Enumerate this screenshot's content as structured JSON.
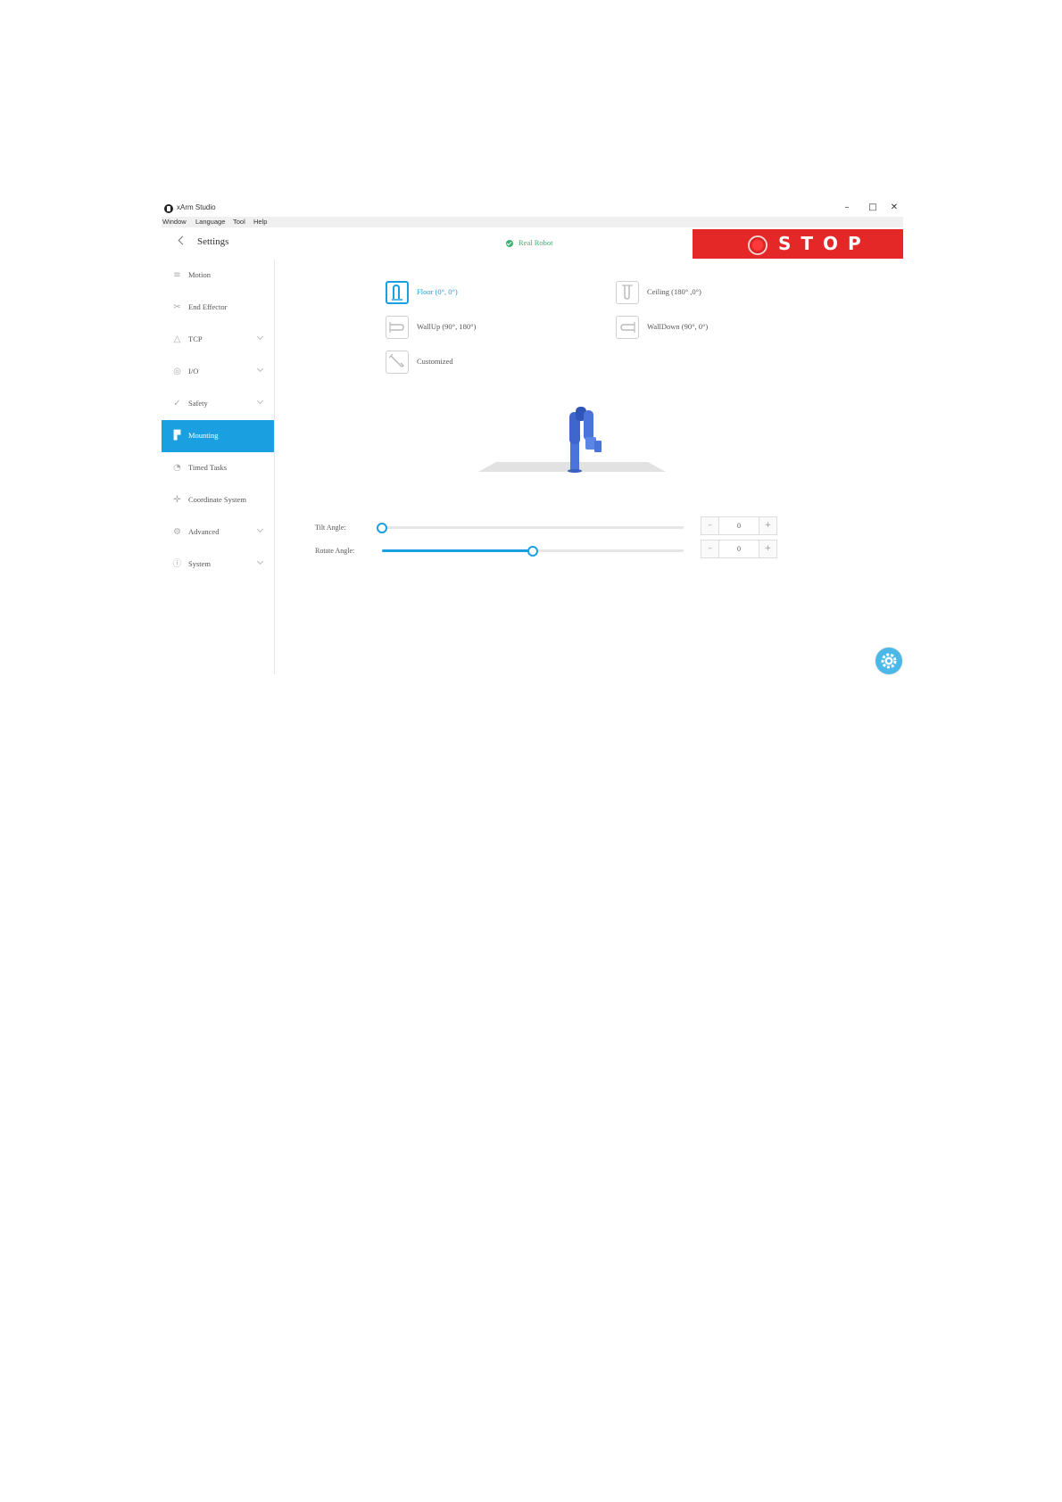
{
  "window": {
    "title": "xArm Studio",
    "controls": {
      "minimize": "–",
      "maximize": "□",
      "close": "✕"
    }
  },
  "menu": [
    "Window",
    "Language",
    "Tool",
    "Help"
  ],
  "header": {
    "title": "Settings",
    "status": "Real Robot",
    "stop_label": "STOP"
  },
  "colors": {
    "accent": "#1aa0e0",
    "stop": "#e42828",
    "status_ok": "#3cb371"
  },
  "sidebar": {
    "items": [
      {
        "label": "Motion",
        "icon": "motion-icon"
      },
      {
        "label": "End Effector",
        "icon": "end-effector-icon"
      },
      {
        "label": "TCP",
        "icon": "tcp-icon",
        "expandable": true
      },
      {
        "label": "I/O",
        "icon": "io-icon",
        "expandable": true
      },
      {
        "label": "Safety",
        "icon": "safety-icon",
        "expandable": true
      },
      {
        "label": "Mounting",
        "icon": "mounting-icon",
        "active": true
      },
      {
        "label": "Timed Tasks",
        "icon": "timed-tasks-icon"
      },
      {
        "label": "Coordinate System",
        "icon": "coordinate-system-icon"
      },
      {
        "label": "Advanced",
        "icon": "advanced-icon",
        "expandable": true
      },
      {
        "label": "System",
        "icon": "system-icon",
        "expandable": true
      }
    ]
  },
  "mounting": {
    "options": [
      {
        "label": "Floor (0°, 0°)",
        "selected": true
      },
      {
        "label": "Ceiling (180° ,0°)"
      },
      {
        "label": "WallUp (90°, 180°)"
      },
      {
        "label": "WallDown (90°, 0°)"
      },
      {
        "label": "Customized"
      }
    ]
  },
  "angles": {
    "tilt": {
      "label": "Tilt Angle:",
      "value": "0",
      "fraction": 0.0
    },
    "rotate": {
      "label": "Rotate Angle:",
      "value": "0",
      "fraction": 0.5
    },
    "minus": "–",
    "plus": "+"
  }
}
